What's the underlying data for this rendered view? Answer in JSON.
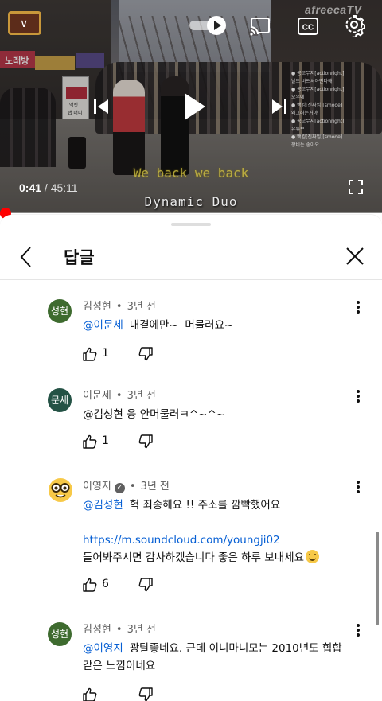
{
  "player": {
    "current_time": "0:41",
    "separator": " / ",
    "duration": "45:11",
    "progress_fraction": 0.015,
    "lyric_line": "We back we back",
    "artist_line": "Dynamic Duo",
    "brand_watermark": "afreecaTV",
    "stand_text_1": "맥킷",
    "stand_text_2": "랩 머니",
    "shop_sign": "노래방",
    "watermark_lines": [
      "● 공고무지[actionright]",
      "날도 바쁘셔야만다해",
      "● 공고무지[actionright]",
      "오우예",
      "● 백킴[진짜임][smooe]",
      "왜그러는거야",
      "● 공고무지[actionright]",
      "유튜브",
      "● 백킴[진짜임][smooe]",
      "장비는 좋아요",
      "● 공고무지[actionright]",
      "유튜브"
    ]
  },
  "sheet": {
    "title": "답글"
  },
  "comments": [
    {
      "avatar_text": "성현",
      "avatar_color": "#3e6b2f",
      "author": "김성현",
      "verified": false,
      "age": "3년 전",
      "mention": "@이문세",
      "text": "내곁에만~  머물러요~",
      "likes": "1"
    },
    {
      "avatar_text": "문세",
      "avatar_color": "#245245",
      "author": "이문세",
      "verified": false,
      "age": "3년 전",
      "mention": "",
      "text": "@김성현 응 안머물러ㅋ^~^~",
      "likes": "1"
    },
    {
      "avatar_text": "",
      "avatar_icon": "nerd-face-icon",
      "author": "이영지",
      "verified": true,
      "age": "3년 전",
      "mention": "@김성현",
      "text": "헉 죄송해요 !! 주소를 깜빡했어요",
      "link": "https://m.soundcloud.com/youngji02",
      "text2": "들어봐주시면 감사하겠습니다 좋은 하루 보내세요",
      "likes": "6"
    },
    {
      "avatar_text": "성현",
      "avatar_color": "#3e6b2f",
      "author": "김성현",
      "verified": false,
      "age": "3년 전",
      "mention": "@이영지",
      "text": "광탈좋네요. 근데 이니마니모는 2010년도 힙합",
      "text2": "같은 느낌이네요",
      "likes": ""
    }
  ],
  "icons": {
    "logo": "channel-logo-icon",
    "autoplay": "autoplay-toggle-icon",
    "cast": "cast-icon",
    "captions": "captions-icon",
    "settings": "settings-gear-icon",
    "prev": "previous-icon",
    "play": "play-icon",
    "next": "next-icon",
    "fullscreen": "fullscreen-icon",
    "back": "back-chevron-icon",
    "close": "close-icon",
    "like": "thumbs-up-icon",
    "dislike": "thumbs-down-icon",
    "more": "more-vert-icon",
    "emoji": "smiling-face-icon"
  },
  "colors": {
    "accent_red": "#ff0000",
    "link_blue": "#065fd4",
    "lyric_yellow": "#d4c441"
  }
}
